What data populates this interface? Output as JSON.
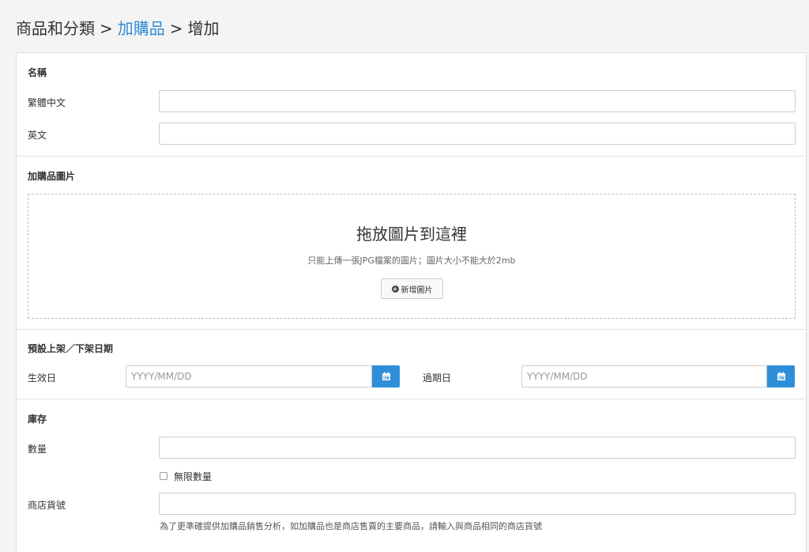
{
  "breadcrumb": {
    "item1": "商品和分類",
    "sep1": ">",
    "item2": "加購品",
    "sep2": ">",
    "item3": "增加"
  },
  "name_section": {
    "title": "名稱",
    "field_zh_label": "繁體中文",
    "field_zh_value": "",
    "field_en_label": "英文",
    "field_en_value": ""
  },
  "image_section": {
    "title": "加購品圖片",
    "drop_title": "拖放圖片到這裡",
    "drop_hint": "只能上傳一張JPG檔案的圖片；圖片大小不能大於2mb",
    "add_button": "新增圖片",
    "add_icon": "plus-circle-icon"
  },
  "date_section": {
    "title": "預設上架／下架日期",
    "start_label": "生效日",
    "start_placeholder": "YYYY/MM/DD",
    "end_label": "過期日",
    "end_placeholder": "YYYY/MM/DD",
    "calendar_icon": "calendar-icon",
    "accent_color": "#2e8fd8"
  },
  "stock_section": {
    "title": "庫存",
    "quantity_label": "數量",
    "quantity_value": "",
    "unlimited_label": "無限數量",
    "unlimited_checked": false,
    "sku_label": "商店貨號",
    "sku_value": "",
    "sku_help": "為了更準確提供加購品銷售分析，如加購品也是商店售賣的主要商品，請輸入與商品相同的商店貨號"
  },
  "colors": {
    "link": "#2e8bd6"
  }
}
